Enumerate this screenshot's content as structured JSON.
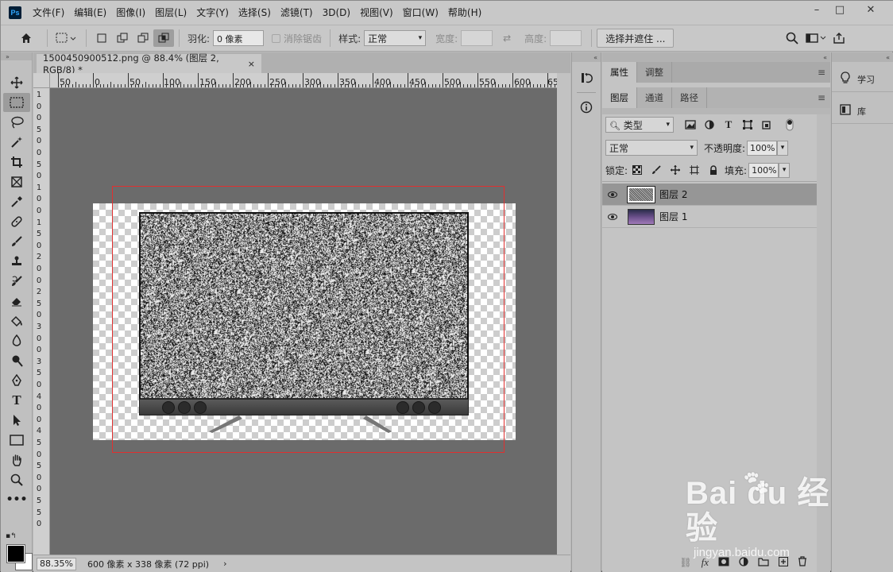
{
  "app": {
    "logo": "Ps"
  },
  "menu": [
    "文件(F)",
    "编辑(E)",
    "图像(I)",
    "图层(L)",
    "文字(Y)",
    "选择(S)",
    "滤镜(T)",
    "3D(D)",
    "视图(V)",
    "窗口(W)",
    "帮助(H)"
  ],
  "window_controls": {
    "minimize": "–",
    "maximize": "□",
    "close": "✕"
  },
  "options": {
    "feather_label": "羽化:",
    "feather_value": "0 像素",
    "antialias_label": "消除锯齿",
    "style_label": "样式:",
    "style_value": "正常",
    "width_label": "宽度:",
    "height_label": "高度:",
    "select_mask_button": "选择并遮住 ..."
  },
  "document": {
    "tab_title": "1500450900512.png @ 88.4% (图层 2, RGB/8) *",
    "close": "×",
    "zoom": "88.35%",
    "size_info": "600 像素 x 338 像素 (72 ppi)",
    "status_arrow": "›"
  },
  "ruler": {
    "h_labels": [
      "50",
      "0",
      "50",
      "100",
      "150",
      "200",
      "250",
      "300",
      "350",
      "400",
      "450",
      "500",
      "550",
      "600",
      "65"
    ],
    "v_labels": [
      "1",
      "0",
      "0",
      "5",
      "0",
      "0",
      "5",
      "0",
      "1",
      "0",
      "0",
      "1",
      "5",
      "0",
      "2",
      "0",
      "0",
      "2",
      "5",
      "0",
      "3",
      "0",
      "0",
      "3",
      "5",
      "0",
      "4",
      "0",
      "0",
      "4",
      "5",
      "0",
      "5",
      "0",
      "0",
      "5",
      "5",
      "0"
    ]
  },
  "panels": {
    "top_tabs": [
      "属性",
      "调整"
    ],
    "layer_tabs": [
      "图层",
      "通道",
      "路径"
    ],
    "filter_kind": "类型",
    "blend_mode": "正常",
    "opacity_label": "不透明度:",
    "opacity_value": "100%",
    "lock_label": "锁定:",
    "fill_label": "填充:",
    "fill_value": "100%",
    "layers": [
      {
        "name": "图层 2",
        "selected": true
      },
      {
        "name": "图层 1",
        "selected": false
      }
    ],
    "bottom_fx": "fx"
  },
  "right_panel": {
    "learn": "学习",
    "library": "库"
  },
  "watermark": {
    "brand": "Bai du 经验",
    "url": "jingyan.baidu.com"
  },
  "colors": {
    "selection_marquee": "#e03030",
    "canvas_bg": "#6b6b6b",
    "ps_logo_bg": "#001e36",
    "ps_logo_fg": "#31a8ff"
  }
}
